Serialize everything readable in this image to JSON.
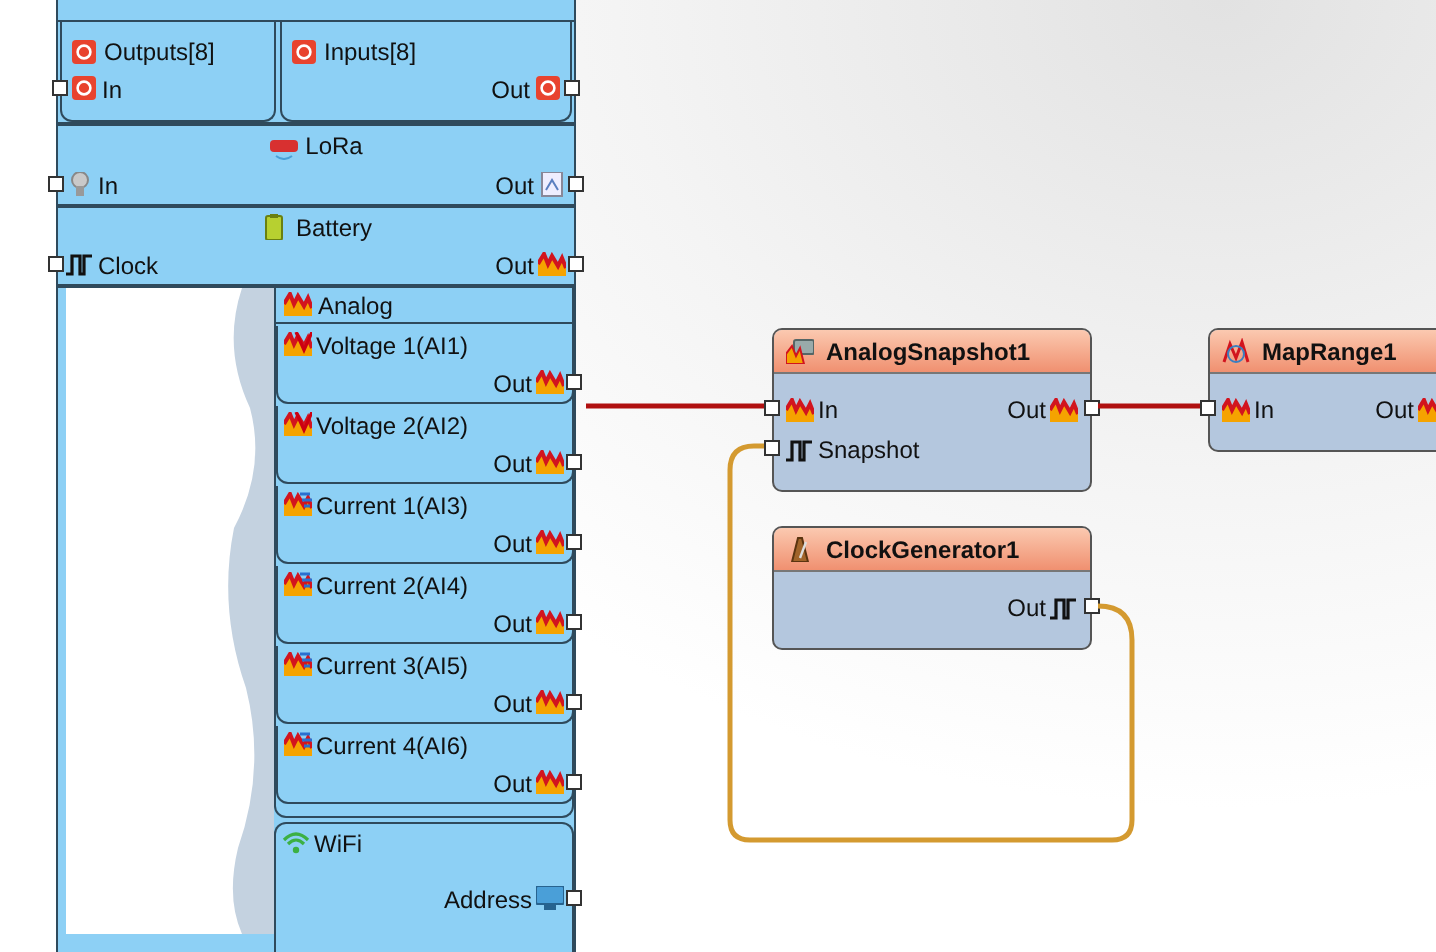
{
  "board": {
    "top_blocks": [
      {
        "kind": "outputs",
        "title": "Outputs[8]",
        "pin": {
          "label": "In",
          "kind": "digital"
        }
      },
      {
        "kind": "inputs",
        "title": "Inputs[8]",
        "pin": {
          "label": "Out",
          "kind": "digital"
        }
      }
    ],
    "sections": [
      {
        "kind": "lora",
        "title": "LoRa",
        "in": {
          "label": "In",
          "kind": "lora_in"
        },
        "out": {
          "label": "Out",
          "kind": "lora_out"
        }
      },
      {
        "kind": "battery",
        "title": "Battery",
        "in": {
          "label": "Clock",
          "kind": "clock"
        },
        "out": {
          "label": "Out",
          "kind": "analog"
        }
      }
    ],
    "analog": {
      "title": "Analog",
      "channels": [
        {
          "kind": "voltage",
          "name": "Voltage 1(AI1)",
          "out": "Out"
        },
        {
          "kind": "voltage",
          "name": "Voltage 2(AI2)",
          "out": "Out"
        },
        {
          "kind": "current",
          "name": "Current 1(AI3)",
          "out": "Out"
        },
        {
          "kind": "current",
          "name": "Current 2(AI4)",
          "out": "Out"
        },
        {
          "kind": "current",
          "name": "Current 3(AI5)",
          "out": "Out"
        },
        {
          "kind": "current",
          "name": "Current 4(AI6)",
          "out": "Out"
        }
      ]
    },
    "wifi": {
      "title": "WiFi",
      "pin": {
        "label": "Address",
        "kind": "address"
      }
    }
  },
  "components": [
    {
      "kind": "snapshot",
      "title": "AnalogSnapshot1",
      "rows": [
        {
          "in": {
            "label": "In",
            "kind": "analog"
          },
          "out": {
            "label": "Out",
            "kind": "analog"
          }
        },
        {
          "in": {
            "label": "Snapshot",
            "kind": "clock"
          }
        }
      ]
    },
    {
      "kind": "clock_generator",
      "title": "ClockGenerator1",
      "rows": [
        {
          "out": {
            "label": "Out",
            "kind": "clock"
          }
        }
      ]
    },
    {
      "kind": "map_range",
      "title": "MapRange1",
      "rows": [
        {
          "in": {
            "label": "In",
            "kind": "analog"
          },
          "out": {
            "label": "Out",
            "kind": "analog"
          }
        }
      ]
    }
  ]
}
